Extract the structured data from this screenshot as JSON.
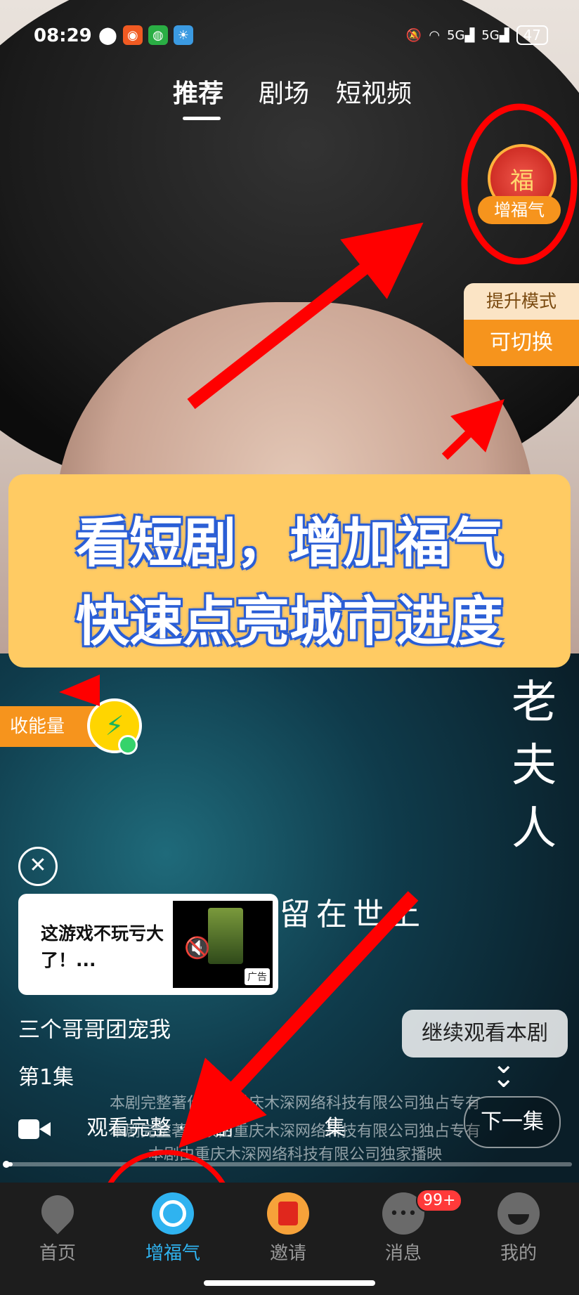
{
  "status_bar": {
    "time": "08:29",
    "signal_1": "5G",
    "signal_2": "5G",
    "battery": "47"
  },
  "top_tabs": [
    {
      "label": "推荐",
      "active": true
    },
    {
      "label": "剧场",
      "active": false
    },
    {
      "label": "短视频",
      "active": false
    }
  ],
  "fu_button": {
    "icon_text": "福",
    "label": "增福气"
  },
  "mode_card": {
    "top": "提升模式",
    "bottom": "可切换"
  },
  "headline": {
    "line1": "看短剧，增加福气",
    "line2": "快速点亮城市进度"
  },
  "energy": {
    "label": "收能量"
  },
  "video_overlay": {
    "vertical_title": [
      "老",
      "夫",
      "人"
    ],
    "subtitle": "留在世上"
  },
  "ad": {
    "text": "这游戏不玩亏大了！...",
    "tag": "广告"
  },
  "drama": {
    "name": "三个哥哥团宠我",
    "episode": "第1集",
    "continue_label": "继续观看本剧",
    "copyright_1": "本剧完整著作权由重庆木深网络科技有限公司独占专有",
    "copyright_2": "本剧完整著作权由重庆木深网络科技有限公司独占专有",
    "copyright_3": "本剧由重庆木深网络科技有限公司独家播映",
    "watch_full": "观看完整 · 短剧",
    "watch_tail": "集",
    "next_label": "下一集",
    "progress": 0.01
  },
  "bottom_nav": [
    {
      "label": "首页",
      "icon": "location-pin-icon",
      "active": false
    },
    {
      "label": "增福气",
      "icon": "fu-ring-icon",
      "active": true
    },
    {
      "label": "邀请",
      "icon": "red-envelope-icon",
      "active": false
    },
    {
      "label": "消息",
      "icon": "chat-bubble-icon",
      "active": false
    },
    {
      "label": "我的",
      "icon": "smile-face-icon",
      "active": false
    }
  ],
  "message_badge": "99+",
  "colors": {
    "accent_orange": "#f6941d",
    "nav_active_blue": "#2fb3f0",
    "annotation_red": "#ff0000",
    "headline_blue": "#2b5fd6"
  }
}
